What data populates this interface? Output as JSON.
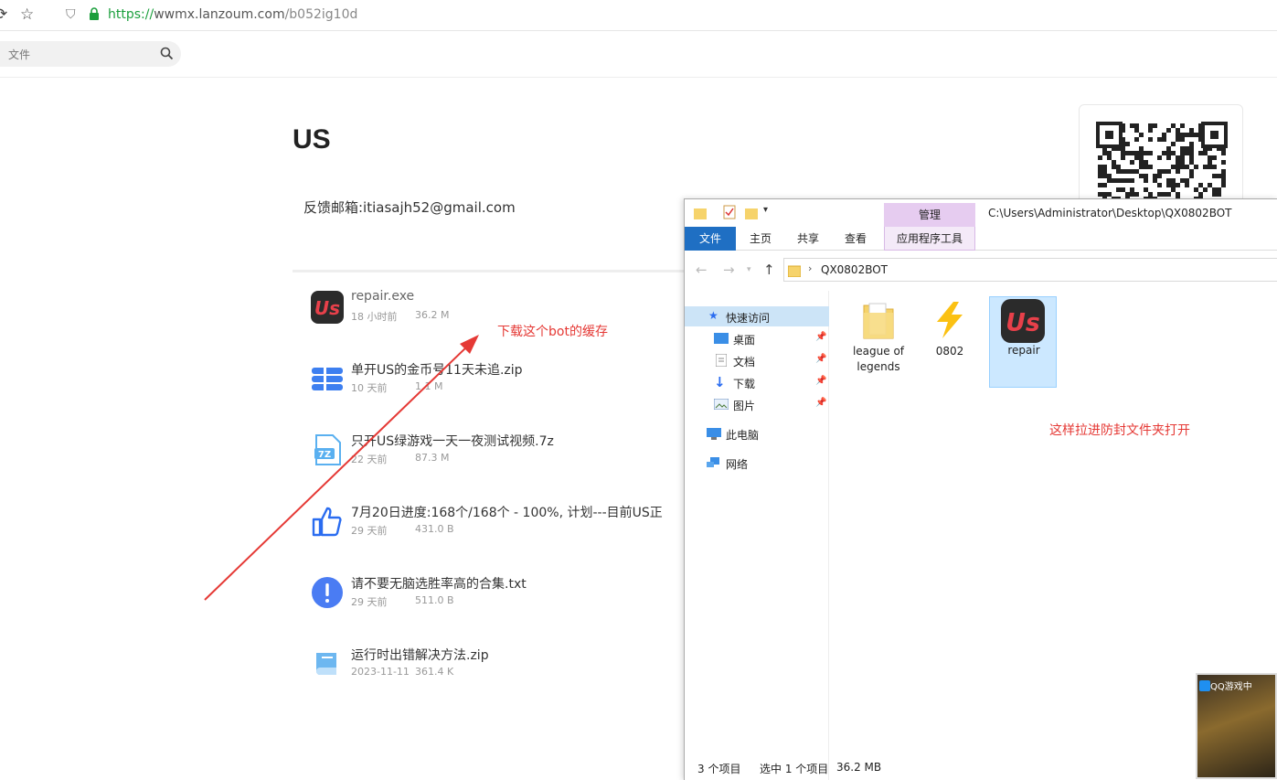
{
  "browser": {
    "url_scheme": "https://",
    "url_host": "wwmx.lanzoum.com",
    "url_path": "/b052ig10d",
    "search_placeholder": "文件"
  },
  "page": {
    "title": "US",
    "feedback_email": "反馈邮箱:itiasajh52@gmail.com"
  },
  "files": [
    {
      "name": "repair.exe",
      "date": "18 小时前",
      "size": "36.2 M",
      "icon": "us-app-icon"
    },
    {
      "name": "单开US的金币号11天未追.zip",
      "date": "10 天前",
      "size": "1.1 M",
      "icon": "zip-icon"
    },
    {
      "name": "只开US绿游戏一天一夜测试视频.7z",
      "date": "22 天前",
      "size": "87.3 M",
      "icon": "7z-icon"
    },
    {
      "name": "7月20日进度:168个/168个 - 100%, 计划---目前US正",
      "date": "29 天前",
      "size": "431.0 B",
      "icon": "thumbs-up-icon"
    },
    {
      "name": "请不要无脑选胜率高的合集.txt",
      "date": "29 天前",
      "size": "511.0 B",
      "icon": "exclamation-icon"
    },
    {
      "name": "运行时出错解决方法.zip",
      "date": "2023-11-11",
      "size": "361.4 K",
      "icon": "book-icon"
    }
  ],
  "annotations": {
    "download_note": "下载这个bot的缓存",
    "drag_note": "这样拉进防封文件夹打开"
  },
  "explorer": {
    "context_tab": "管理",
    "title_path": "C:\\Users\\Administrator\\Desktop\\QX0802BOT",
    "ribbon_tabs": [
      "文件",
      "主页",
      "共享",
      "查看",
      "应用程序工具"
    ],
    "breadcrumb": "QX0802BOT",
    "nav": {
      "quick_access": "快速访问",
      "desktop": "桌面",
      "documents": "文档",
      "downloads": "下载",
      "pictures": "图片",
      "this_pc": "此电脑",
      "network": "网络"
    },
    "items": [
      {
        "label": "league of legends",
        "icon": "folder-icon"
      },
      {
        "label": "0802",
        "icon": "lightning-icon"
      },
      {
        "label": "repair",
        "icon": "us-app-icon"
      }
    ],
    "status": {
      "count": "3 个项目",
      "selected": "选中 1 个项目",
      "size": "36.2 MB"
    }
  },
  "qq_thumbnail": {
    "title": "QQ游戏中"
  }
}
